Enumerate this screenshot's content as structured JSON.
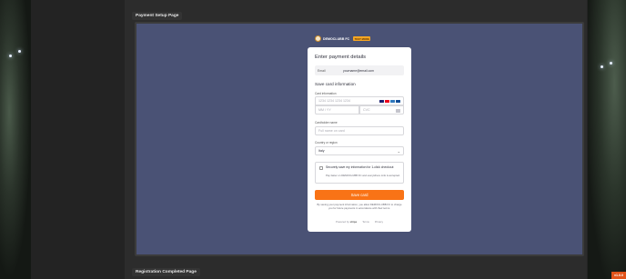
{
  "sections": {
    "payment_title": "Payment Setup Page",
    "registration_title": "Registration Completed Page"
  },
  "brand": {
    "name": "DEMOCLUBB FC",
    "badge": "TEST MODE"
  },
  "checkout": {
    "title": "Enter payment details",
    "email_label": "Email",
    "email_value": "yourname@email.com",
    "save_card_title": "Save card information",
    "card_info_label": "Card information",
    "card_number_placeholder": "1234 1234 1234 1234",
    "expiry_placeholder": "MM / YY",
    "cvc_placeholder": "CVC",
    "cardholder_label": "Cardholder name",
    "cardholder_placeholder": "Full name on card",
    "country_label": "Country or region",
    "country_value": "Italy",
    "save_info_heading": "Securely save my information for 1-click checkout",
    "save_info_sub": "Pay faster on DEMOCLUBB FC and everywhere Link is accepted.",
    "save_button": "Save card",
    "legal_text": "By saving your payment information, you allow DEMOCLUBB FC to charge you for future payments in accordance with their terms.",
    "powered_by": "Powered by",
    "powered_brand": "stripe",
    "terms_link": "Terms",
    "privacy_link": "Privacy"
  },
  "card_brand_colors": [
    "#1a1f71",
    "#eb001b",
    "#2e77bc",
    "#0e4c96"
  ],
  "version": "v1.0.0",
  "colors": {
    "accent": "#f97316",
    "frame_bg": "#4a5275",
    "version_bg": "#e2541b"
  }
}
